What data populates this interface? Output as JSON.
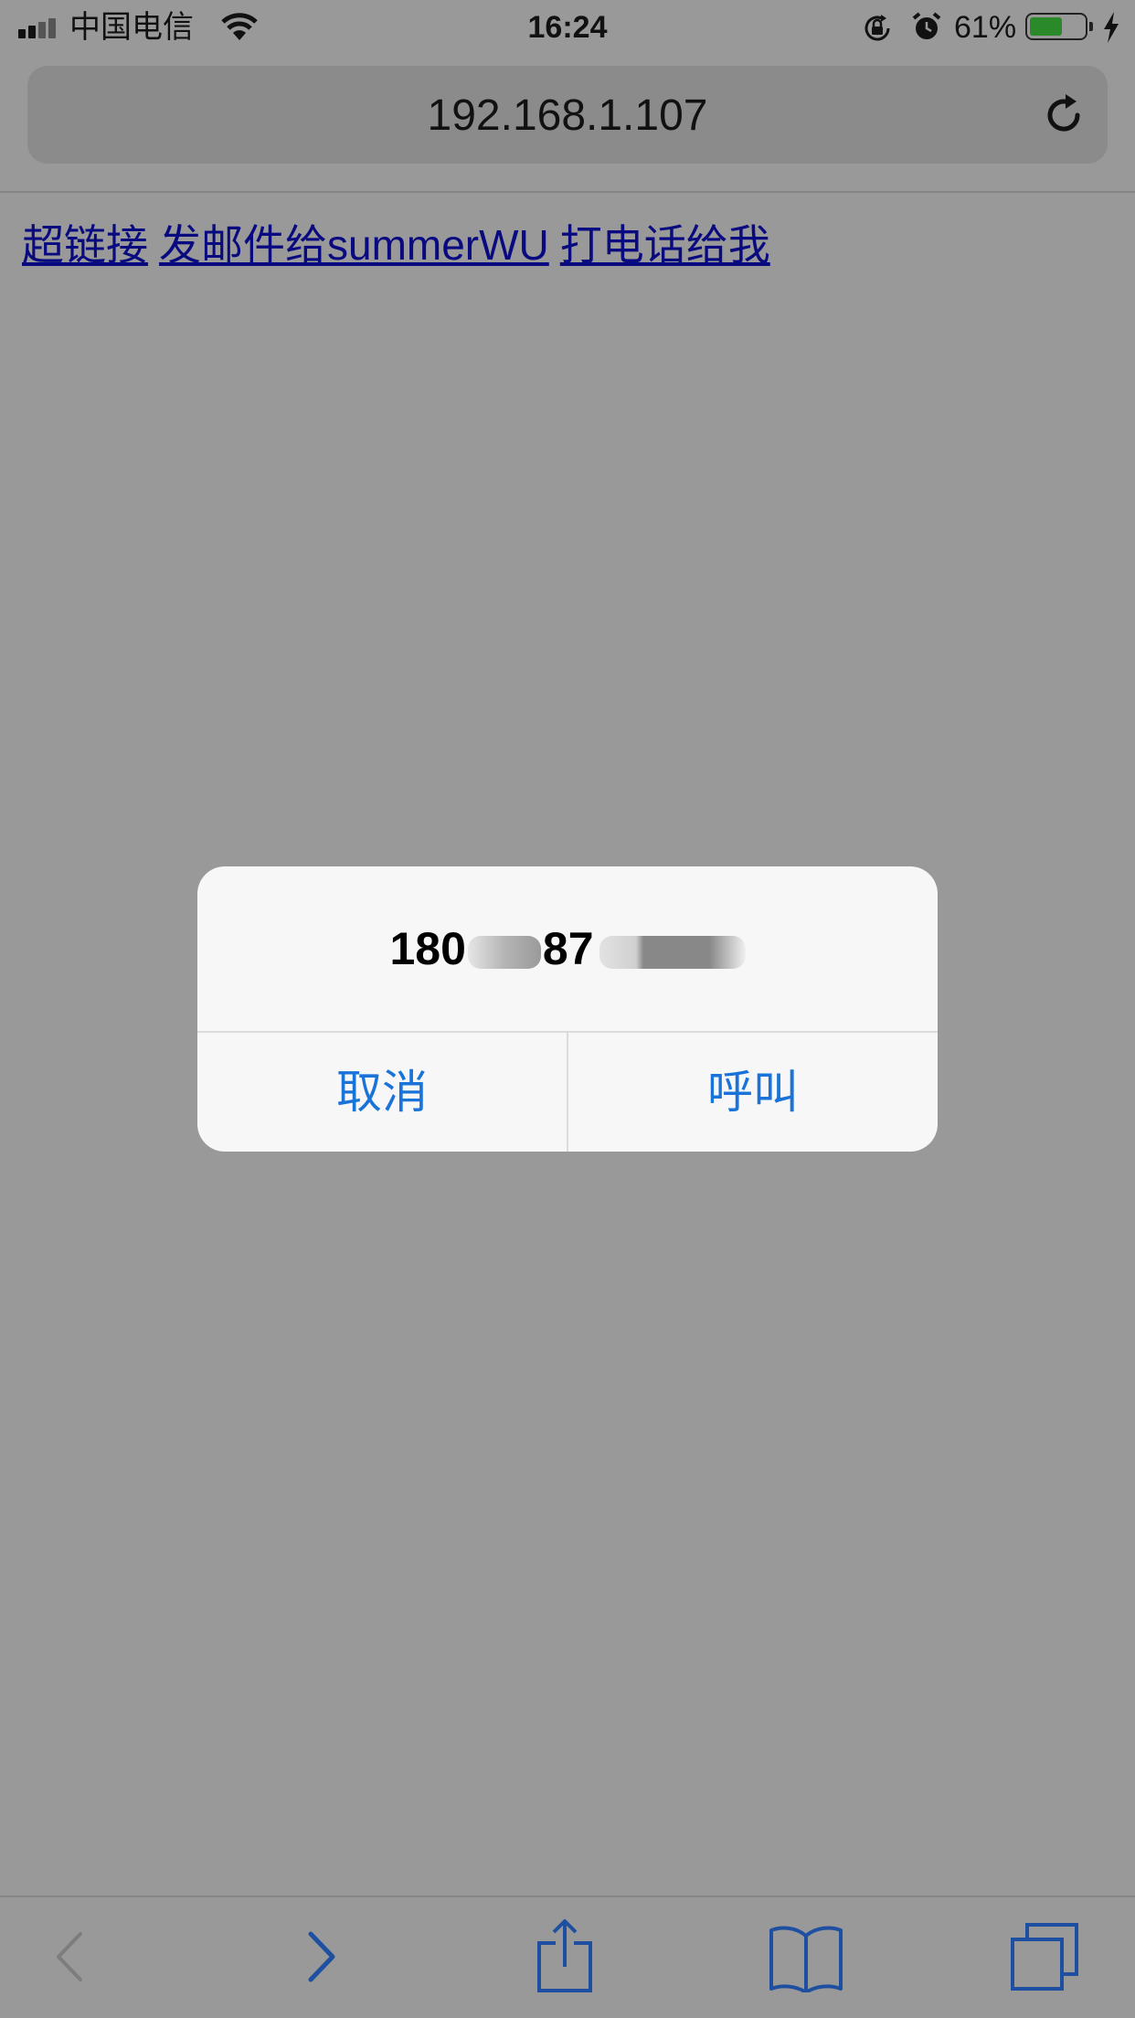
{
  "status_bar": {
    "carrier": "中国电信",
    "time": "16:24",
    "battery_percent": "61%",
    "battery_level": 0.61,
    "signal_bars_active": 2,
    "icons": [
      "signal-icon",
      "wifi-icon",
      "rotation-lock-icon",
      "alarm-icon",
      "battery-icon",
      "charging-icon"
    ]
  },
  "address_bar": {
    "url": "192.168.1.107",
    "reload_icon": "reload-icon"
  },
  "page": {
    "links": [
      {
        "label": "超链接"
      },
      {
        "label": "发邮件给summerWU"
      },
      {
        "label": "打电话给我"
      }
    ]
  },
  "dialog": {
    "number_part1": "180",
    "number_part2": "87",
    "cancel_label": "取消",
    "call_label": "呼叫",
    "button_color": "#1a73d9"
  },
  "toolbar": {
    "icons": [
      "back-icon",
      "forward-icon",
      "share-icon",
      "bookmarks-icon",
      "tabs-icon"
    ]
  },
  "colors": {
    "dim_background": "#999999",
    "dialog_background": "#f7f7f7",
    "link_color": "#0a0a80"
  }
}
